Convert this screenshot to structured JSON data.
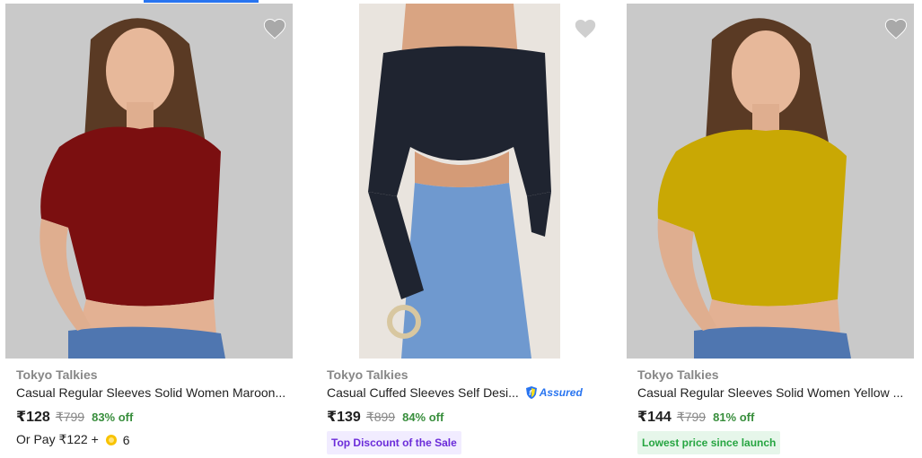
{
  "colors": {
    "accent": "#2874f0",
    "discount_green": "#388e3c",
    "muted": "#878787",
    "tag_purple_bg": "#f1ecff",
    "tag_purple_text": "#6b2cd9",
    "tag_green_bg": "#e6f6ea",
    "tag_green_text": "#26a541"
  },
  "products": [
    {
      "brand": "Tokyo Talkies",
      "title": "Casual Regular Sleeves Solid Women Maroon...",
      "price": "₹128",
      "mrp": "₹799",
      "discount": "83% off",
      "pay_text": "Or Pay ₹122 +",
      "coins": "6",
      "icon": "heart-icon",
      "shirt_color": "#7b0f10"
    },
    {
      "brand": "Tokyo Talkies",
      "title": "Casual Cuffed Sleeves Self Desi...",
      "assured_label": "Assured",
      "price": "₹139",
      "mrp": "₹899",
      "discount": "84% off",
      "tag": "Top Discount of the Sale",
      "icon": "heart-icon",
      "shirt_color": "#1f2430"
    },
    {
      "brand": "Tokyo Talkies",
      "title": "Casual Regular Sleeves Solid Women Yellow ...",
      "price": "₹144",
      "mrp": "₹799",
      "discount": "81% off",
      "tag": "Lowest price since launch",
      "icon": "heart-icon",
      "shirt_color": "#c9a804"
    }
  ]
}
